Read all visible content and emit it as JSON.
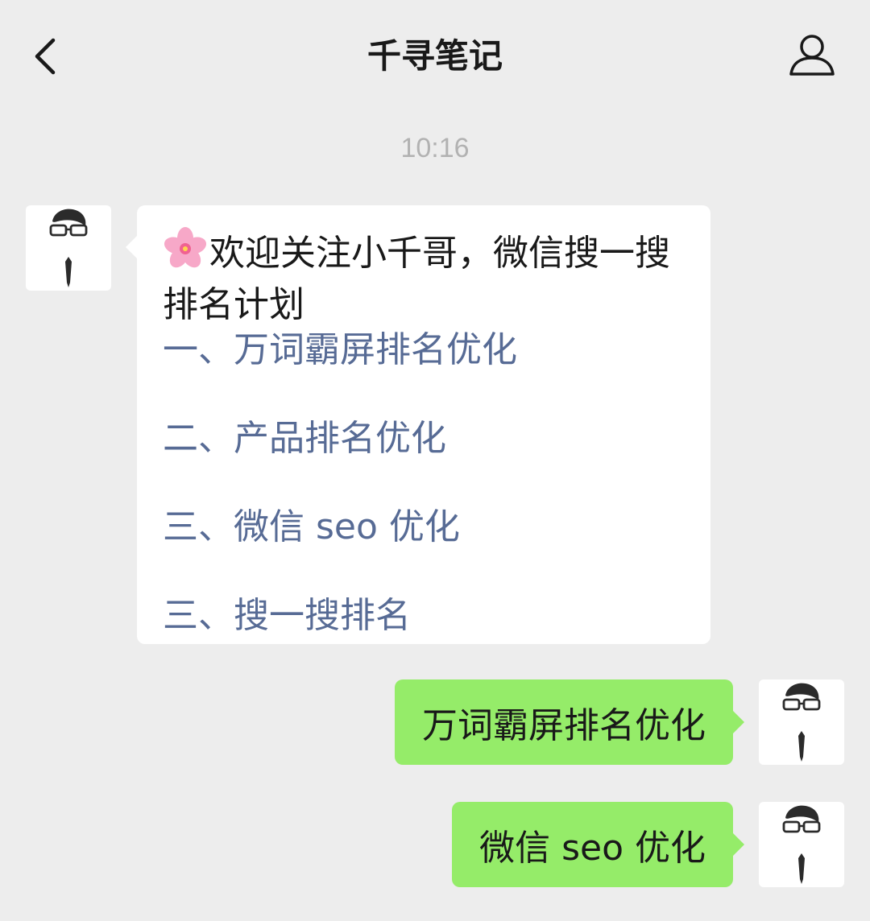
{
  "header": {
    "title": "千寻笔记",
    "back_icon": "chevron-left-icon",
    "profile_icon": "person-icon"
  },
  "chat": {
    "timestamp": "10:16",
    "incoming": {
      "emoji": "cherry-blossom-emoji",
      "intro": "欢迎关注小千哥，微信搜一搜排名计划",
      "menu": [
        "一、万词霸屏排名优化",
        "二、产品排名优化",
        "三、微信 seo 优化",
        "三、搜一搜排名"
      ]
    },
    "outgoing": [
      "万词霸屏排名优化",
      "微信 seo 优化"
    ]
  },
  "colors": {
    "background": "#ededed",
    "incoming_bubble": "#ffffff",
    "outgoing_bubble": "#95ec69",
    "link": "#576b95",
    "timestamp": "#b2b2b2"
  }
}
